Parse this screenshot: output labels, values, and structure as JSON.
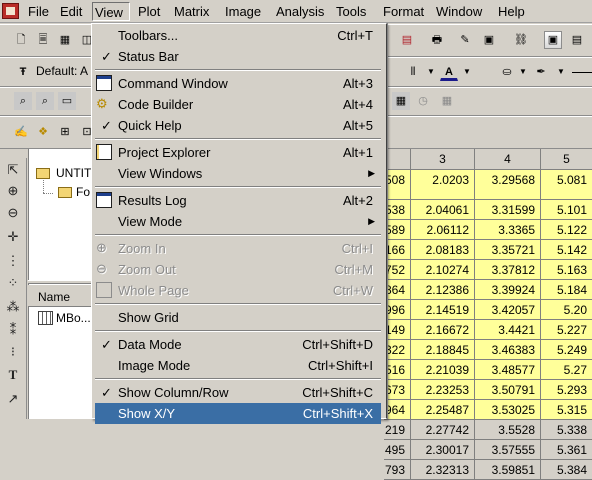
{
  "menubar": {
    "items": [
      "File",
      "Edit",
      "View",
      "Plot",
      "Matrix",
      "Image",
      "Analysis",
      "Tools",
      "Format",
      "Window",
      "Help"
    ]
  },
  "toolbar": {
    "font_name": "Default: A"
  },
  "project_tree": {
    "root_label": "UNTIT",
    "child_label": "Fo",
    "name_column": "Name",
    "item_label": "MBo..."
  },
  "grid": {
    "headers": [
      "3",
      "4",
      "5"
    ],
    "rows": [
      [
        "508",
        "2.0203",
        "3.29568",
        "5.081"
      ],
      [
        "538",
        "2.04061",
        "3.31599",
        "5.101"
      ],
      [
        "589",
        "2.06112",
        "3.3365",
        "5.122"
      ],
      [
        "166",
        "2.08183",
        "3.35721",
        "5.142"
      ],
      [
        "752",
        "2.10274",
        "3.37812",
        "5.163"
      ],
      [
        "864",
        "2.12386",
        "3.39924",
        "5.184"
      ],
      [
        "996",
        "2.14519",
        "3.42057",
        "5.20"
      ],
      [
        "149",
        "2.16672",
        "3.4421",
        "5.227"
      ],
      [
        "322",
        "2.18845",
        "3.46383",
        "5.249"
      ],
      [
        "516",
        "2.21039",
        "3.48577",
        "5.27"
      ],
      [
        "673",
        "2.23253",
        "3.50791",
        "5.293"
      ],
      [
        "964",
        "2.25487",
        "3.53025",
        "5.315"
      ],
      [
        "219",
        "2.27742",
        "3.5528",
        "5.338"
      ],
      [
        "495",
        "2.30017",
        "3.57555",
        "5.361"
      ],
      [
        "793",
        "2.32313",
        "3.59851",
        "5.384"
      ]
    ]
  },
  "view_menu": {
    "items": [
      {
        "label": "Toolbars...",
        "shortcut": "Ctrl+T"
      },
      {
        "label": "Status Bar",
        "shortcut": ""
      },
      {
        "label": "Command Window",
        "shortcut": "Alt+3"
      },
      {
        "label": "Code Builder",
        "shortcut": "Alt+4"
      },
      {
        "label": "Quick Help",
        "shortcut": "Alt+5"
      },
      {
        "label": "Project Explorer",
        "shortcut": "Alt+1"
      },
      {
        "label": "View Windows",
        "shortcut": ""
      },
      {
        "label": "Results Log",
        "shortcut": "Alt+2"
      },
      {
        "label": "View Mode",
        "shortcut": ""
      },
      {
        "label": "Zoom In",
        "shortcut": "Ctrl+I"
      },
      {
        "label": "Zoom Out",
        "shortcut": "Ctrl+M"
      },
      {
        "label": "Whole Page",
        "shortcut": "Ctrl+W"
      },
      {
        "label": "Show Grid",
        "shortcut": ""
      },
      {
        "label": "Data Mode",
        "shortcut": "Ctrl+Shift+D"
      },
      {
        "label": "Image Mode",
        "shortcut": "Ctrl+Shift+I"
      },
      {
        "label": "Show Column/Row",
        "shortcut": "Ctrl+Shift+C"
      },
      {
        "label": "Show X/Y",
        "shortcut": "Ctrl+Shift+X"
      }
    ]
  },
  "colors": {
    "highlight": "#3a6ea5",
    "grid_bg": "#ffff9a",
    "chrome": "#d4d0c8"
  }
}
